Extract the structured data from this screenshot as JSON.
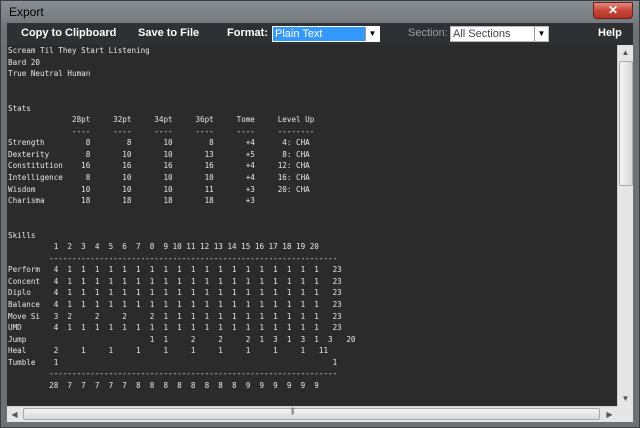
{
  "window": {
    "title": "Export",
    "close_label": "✕"
  },
  "toolbar": {
    "copy_label": "Copy to Clipboard",
    "save_label": "Save to File",
    "format_label": "Format:",
    "format_value": "Plain Text",
    "section_label": "Section:",
    "section_value": "All Sections",
    "help_label": "Help"
  },
  "icons": {
    "close": "close-icon",
    "dropdown": "chevron-down-icon",
    "scroll_up": "arrow-up-icon",
    "scroll_down": "arrow-down-icon",
    "scroll_left": "arrow-left-icon",
    "scroll_right": "arrow-right-icon"
  },
  "colors": {
    "selection": "#3399ff",
    "text_background": "#2b2b2b",
    "text": "#e8e8e8",
    "toolbar": "#2f3033"
  },
  "export_text": "Scream Til They Start Listening\nBard 20\nTrue Neutral Human\n\n\nStats\n              28pt     32pt     34pt     36pt     Tome     Level Up\n              ----     ----     ----     ----     ----     --------\nStrength         8        8       10        8       +4      4: CHA\nDexterity        8       10       10       13       +5      8: CHA\nConstitution    16       16       16       16       +4     12: CHA\nIntelligence     8       10       10       10       +4     16: CHA\nWisdom          10       10       10       11       +3     20: CHA\nCharisma        18       18       18       18       +3\n\n\nSkills\n          1  2  3  4  5  6  7  8  9 10 11 12 13 14 15 16 17 18 19 20\n         ---------------------------------------------------------------\nPerform   4  1  1  1  1  1  1  1  1  1  1  1  1  1  1  1  1  1  1  1   23\nConcent   4  1  1  1  1  1  1  1  1  1  1  1  1  1  1  1  1  1  1  1   23\nDiplo     4  1  1  1  1  1  1  1  1  1  1  1  1  1  1  1  1  1  1  1   23\nBalance   4  1  1  1  1  1  1  1  1  1  1  1  1  1  1  1  1  1  1  1   23\nMove Si   3  2     2     2     2  1  1  1  1  1  1  1  1  1  1  1  1   23\nUMD       4  1  1  1  1  1  1  1  1  1  1  1  1  1  1  1  1  1  1  1   23\nJump                           1  1     2     2     2  1  3  1  3  1  3   20\nHeal      2     1     1     1     1     1     1     1     1     1   11\nTumble    1                                                            1\n         ---------------------------------------------------------------\n         28  7  7  7  7  7  8  8  8  8  8  8  8  8  9  9  9  9  9  9",
  "scrollbar": {
    "grip": "|||"
  }
}
